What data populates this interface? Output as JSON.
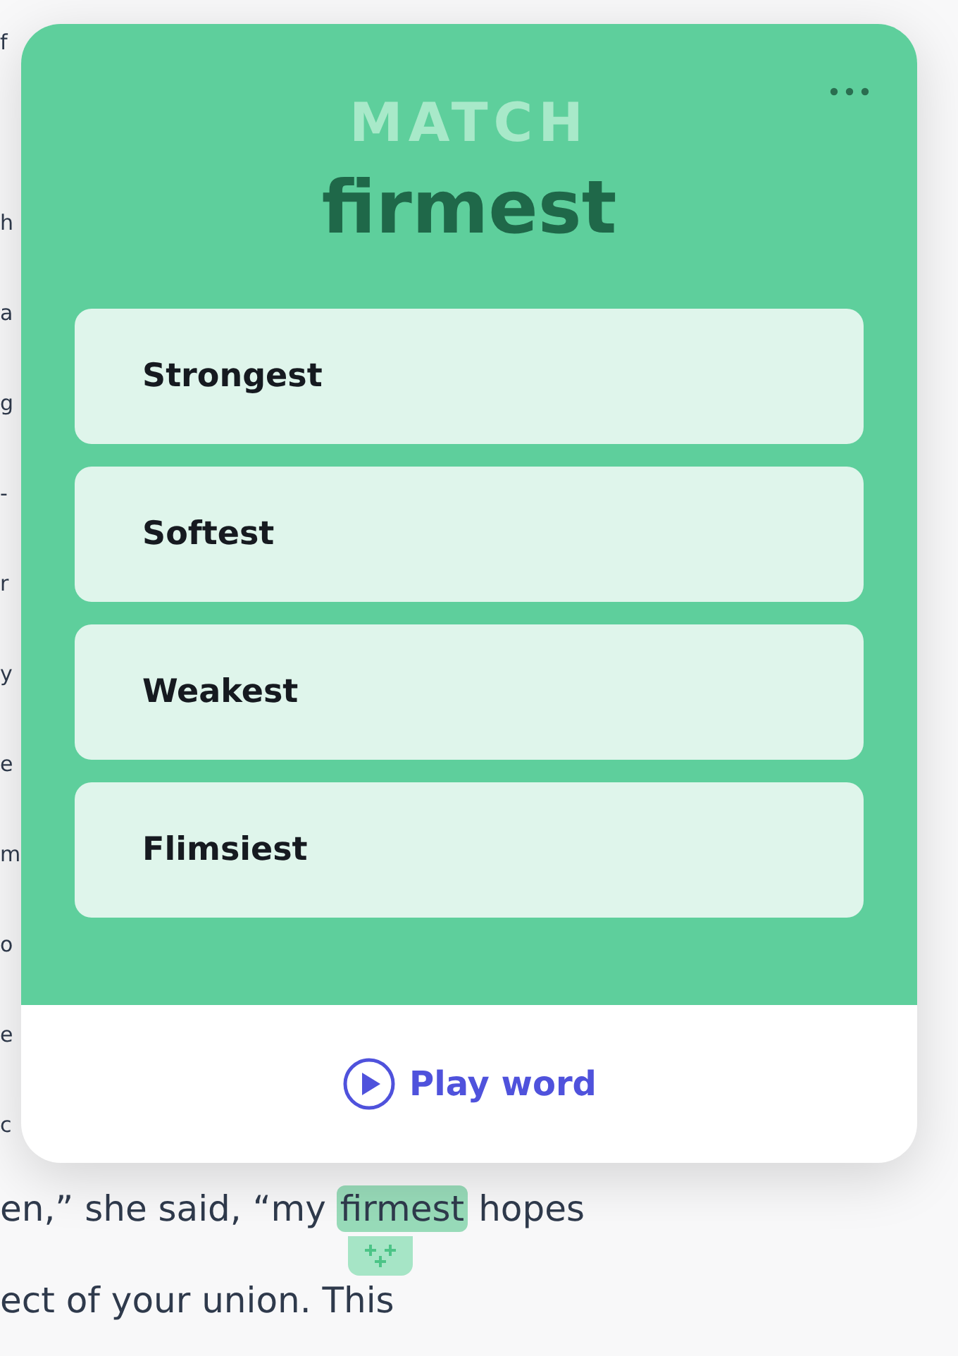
{
  "article": {
    "first_fragment": "f",
    "edge_fragments": [
      "h",
      "a",
      "g",
      "-",
      "r",
      "y",
      "e",
      "m",
      "o",
      "e",
      "c"
    ],
    "highlight_line": {
      "before": "en,” she said, “my",
      "highlight": "firmest",
      "after": "hopes"
    },
    "last_line": "ect of your union. This"
  },
  "card": {
    "label": "MATCH",
    "word": "firmest",
    "options": [
      {
        "label": "Strongest"
      },
      {
        "label": "Softest"
      },
      {
        "label": "Weakest"
      },
      {
        "label": "Flimsiest"
      }
    ],
    "play_button": "Play word"
  }
}
